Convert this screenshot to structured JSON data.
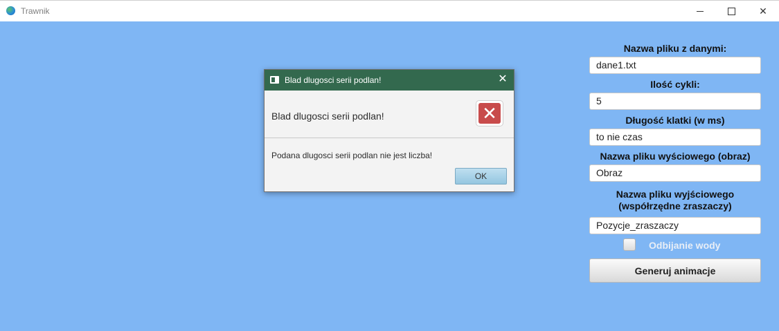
{
  "window": {
    "title": "Trawnik",
    "controls": {
      "minimize": "minimize-icon",
      "maximize": "maximize-icon",
      "close": "close-icon"
    }
  },
  "form": {
    "data_file_label": "Nazwa pliku z danymi:",
    "data_file_value": "dane1.txt",
    "cycles_label": "Ilość cykli:",
    "cycles_value": "5",
    "frame_length_label": "Długość klatki (w ms)",
    "frame_length_value": "to nie czas",
    "output_image_label": "Nazwa pliku wyściowego (obraz)",
    "output_image_value": "Obraz",
    "output_coords_label_line1": "Nazwa pliku wyjściowego",
    "output_coords_label_line2": "(współrzędne zraszaczy)",
    "output_coords_value": "Pozycje_zraszaczy",
    "reflect_water_label": "Odbijanie wody",
    "reflect_water_checked": false,
    "generate_button": "Generuj animacje"
  },
  "dialog": {
    "title": "Blad dlugosci serii podlan!",
    "header": "Blad dlugosci serii podlan!",
    "content": "Podana dlugosci serii podlan nie jest liczba!",
    "ok_button": "OK",
    "icon": "error-icon"
  },
  "colors": {
    "background": "#7fb6f4",
    "dialog_titlebar": "#33694e",
    "error_icon": "#c84b4b"
  }
}
